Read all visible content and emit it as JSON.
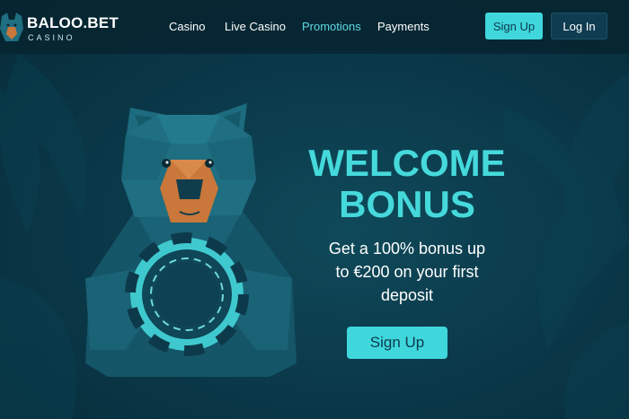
{
  "brand": {
    "name": "BALOO.BET",
    "sub": "CASINO"
  },
  "nav": {
    "links": [
      {
        "label": "Casino",
        "active": false
      },
      {
        "label": "Live Casino",
        "active": false
      },
      {
        "label": "Promotions",
        "active": true
      },
      {
        "label": "Payments",
        "active": false
      }
    ],
    "signup_label": "Sign Up",
    "login_label": "Log In"
  },
  "hero": {
    "title_line1": "WELCOME",
    "title_line2": "BONUS",
    "subtitle_line1": "Get a 100% bonus up",
    "subtitle_line2": "to €200 on your first",
    "subtitle_line3": "deposit",
    "cta_label": "Sign Up"
  },
  "colors": {
    "background": "#0b3a4b",
    "accent": "#3fd7dc",
    "title": "#45d9db",
    "active_link": "#5fd9e3",
    "bear_snout": "#c9773a"
  },
  "icons": [
    "bear-logo-icon",
    "bear-mascot",
    "poker-chip"
  ]
}
